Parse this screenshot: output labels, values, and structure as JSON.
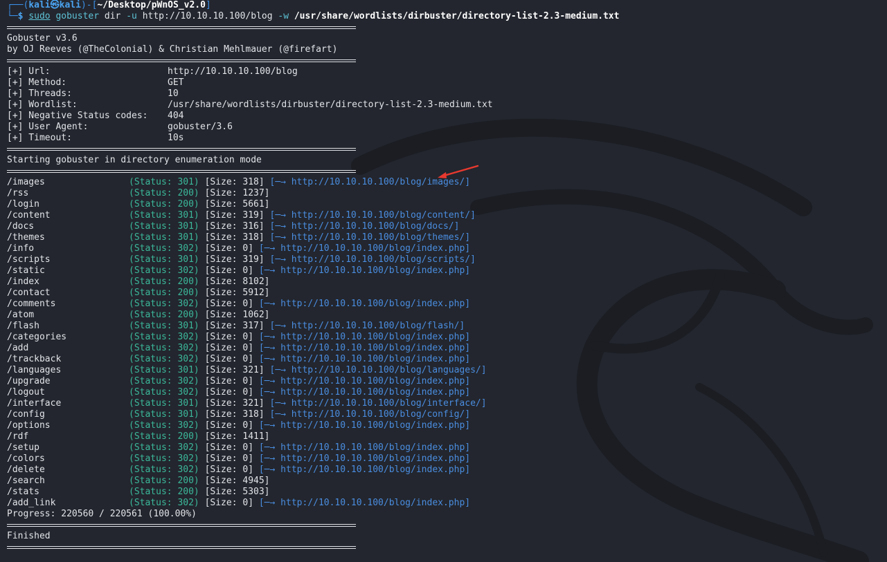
{
  "prompt": {
    "top_left": "┌──(",
    "user": "kali㉿kali",
    "mid": ")-[",
    "path": "~/Desktop/pWnOS_v2.0",
    "end": "]",
    "bottom_left": "└─",
    "dollar": "$"
  },
  "command": {
    "sudo": "sudo",
    "program": "gobuster",
    "mode": "dir",
    "flag_u": "-u",
    "url": "http://10.10.10.100/blog",
    "flag_w": "-w",
    "wordlist": "/usr/share/wordlists/dirbuster/directory-list-2.3-medium.txt"
  },
  "banner": {
    "version": "Gobuster v3.6",
    "authors": "by OJ Reeves (@TheColonial) & Christian Mehlmauer (@firefart)"
  },
  "config": [
    {
      "key": "[+] Url:",
      "value": "http://10.10.10.100/blog"
    },
    {
      "key": "[+] Method:",
      "value": "GET"
    },
    {
      "key": "[+] Threads:",
      "value": "10"
    },
    {
      "key": "[+] Wordlist:",
      "value": "/usr/share/wordlists/dirbuster/directory-list-2.3-medium.txt"
    },
    {
      "key": "[+] Negative Status codes:",
      "value": "404"
    },
    {
      "key": "[+] User Agent:",
      "value": "gobuster/3.6"
    },
    {
      "key": "[+] Timeout:",
      "value": "10s"
    }
  ],
  "start_message": "Starting gobuster in directory enumeration mode",
  "results": [
    {
      "path": "/images",
      "status": "(Status: 301)",
      "size": "[Size: 318]",
      "redirect": "[─→ http://10.10.10.100/blog/images/]"
    },
    {
      "path": "/rss",
      "status": "(Status: 200)",
      "size": "[Size: 1237]",
      "redirect": ""
    },
    {
      "path": "/login",
      "status": "(Status: 200)",
      "size": "[Size: 5661]",
      "redirect": ""
    },
    {
      "path": "/content",
      "status": "(Status: 301)",
      "size": "[Size: 319]",
      "redirect": "[─→ http://10.10.10.100/blog/content/]"
    },
    {
      "path": "/docs",
      "status": "(Status: 301)",
      "size": "[Size: 316]",
      "redirect": "[─→ http://10.10.10.100/blog/docs/]"
    },
    {
      "path": "/themes",
      "status": "(Status: 301)",
      "size": "[Size: 318]",
      "redirect": "[─→ http://10.10.10.100/blog/themes/]"
    },
    {
      "path": "/info",
      "status": "(Status: 302)",
      "size": "[Size: 0]",
      "redirect": "[─→ http://10.10.10.100/blog/index.php]"
    },
    {
      "path": "/scripts",
      "status": "(Status: 301)",
      "size": "[Size: 319]",
      "redirect": "[─→ http://10.10.10.100/blog/scripts/]"
    },
    {
      "path": "/static",
      "status": "(Status: 302)",
      "size": "[Size: 0]",
      "redirect": "[─→ http://10.10.10.100/blog/index.php]"
    },
    {
      "path": "/index",
      "status": "(Status: 200)",
      "size": "[Size: 8102]",
      "redirect": ""
    },
    {
      "path": "/contact",
      "status": "(Status: 200)",
      "size": "[Size: 5912]",
      "redirect": ""
    },
    {
      "path": "/comments",
      "status": "(Status: 302)",
      "size": "[Size: 0]",
      "redirect": "[─→ http://10.10.10.100/blog/index.php]"
    },
    {
      "path": "/atom",
      "status": "(Status: 200)",
      "size": "[Size: 1062]",
      "redirect": ""
    },
    {
      "path": "/flash",
      "status": "(Status: 301)",
      "size": "[Size: 317]",
      "redirect": "[─→ http://10.10.10.100/blog/flash/]"
    },
    {
      "path": "/categories",
      "status": "(Status: 302)",
      "size": "[Size: 0]",
      "redirect": "[─→ http://10.10.10.100/blog/index.php]"
    },
    {
      "path": "/add",
      "status": "(Status: 302)",
      "size": "[Size: 0]",
      "redirect": "[─→ http://10.10.10.100/blog/index.php]"
    },
    {
      "path": "/trackback",
      "status": "(Status: 302)",
      "size": "[Size: 0]",
      "redirect": "[─→ http://10.10.10.100/blog/index.php]"
    },
    {
      "path": "/languages",
      "status": "(Status: 301)",
      "size": "[Size: 321]",
      "redirect": "[─→ http://10.10.10.100/blog/languages/]"
    },
    {
      "path": "/upgrade",
      "status": "(Status: 302)",
      "size": "[Size: 0]",
      "redirect": "[─→ http://10.10.10.100/blog/index.php]"
    },
    {
      "path": "/logout",
      "status": "(Status: 302)",
      "size": "[Size: 0]",
      "redirect": "[─→ http://10.10.10.100/blog/index.php]"
    },
    {
      "path": "/interface",
      "status": "(Status: 301)",
      "size": "[Size: 321]",
      "redirect": "[─→ http://10.10.10.100/blog/interface/]"
    },
    {
      "path": "/config",
      "status": "(Status: 301)",
      "size": "[Size: 318]",
      "redirect": "[─→ http://10.10.10.100/blog/config/]"
    },
    {
      "path": "/options",
      "status": "(Status: 302)",
      "size": "[Size: 0]",
      "redirect": "[─→ http://10.10.10.100/blog/index.php]"
    },
    {
      "path": "/rdf",
      "status": "(Status: 200)",
      "size": "[Size: 1411]",
      "redirect": ""
    },
    {
      "path": "/setup",
      "status": "(Status: 302)",
      "size": "[Size: 0]",
      "redirect": "[─→ http://10.10.10.100/blog/index.php]"
    },
    {
      "path": "/colors",
      "status": "(Status: 302)",
      "size": "[Size: 0]",
      "redirect": "[─→ http://10.10.10.100/blog/index.php]"
    },
    {
      "path": "/delete",
      "status": "(Status: 302)",
      "size": "[Size: 0]",
      "redirect": "[─→ http://10.10.10.100/blog/index.php]"
    },
    {
      "path": "/search",
      "status": "(Status: 200)",
      "size": "[Size: 4945]",
      "redirect": ""
    },
    {
      "path": "/stats",
      "status": "(Status: 200)",
      "size": "[Size: 5303]",
      "redirect": ""
    },
    {
      "path": "/add_link",
      "status": "(Status: 302)",
      "size": "[Size: 0]",
      "redirect": "[─→ http://10.10.10.100/blog/index.php]"
    }
  ],
  "progress": "Progress: 220560 / 220561 (100.00%)",
  "finished": "Finished",
  "colors": {
    "background": "#23262e",
    "text": "#e2e4e9",
    "status": "#3bb89a",
    "link": "#4a8de0",
    "prompt": "#4aa3f0",
    "annotation_arrow": "#e8392f"
  },
  "icons": {
    "background": "kali-dragon-watermark",
    "annotation": "red-arrow-icon"
  }
}
